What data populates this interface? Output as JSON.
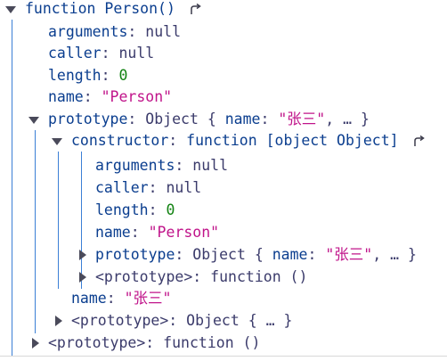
{
  "tree": {
    "root": {
      "kw": "function",
      "name": "Person()",
      "children": {
        "arguments": {
          "key": "arguments",
          "value": "null"
        },
        "caller": {
          "key": "caller",
          "value": "null"
        },
        "length": {
          "key": "length",
          "value": "0"
        },
        "name": {
          "key": "name",
          "value": "\"Person\""
        },
        "prototype": {
          "key": "prototype",
          "summary_type": "Object",
          "summary_open": "{",
          "summary_key": "name",
          "summary_value": "\"张三\"",
          "summary_rest": ", … }",
          "constructor": {
            "key": "constructor",
            "kw": "function",
            "name": {
              "key": "name",
              "value": "\"Person\""
            },
            "arguments": {
              "key": "arguments",
              "value": "null"
            },
            "caller": {
              "key": "caller",
              "value": "null"
            },
            "length": {
              "key": "length",
              "value": "0"
            },
            "prototype": {
              "key": "prototype",
              "summary_type": "Object",
              "summary_open": "{",
              "summary_key": "name",
              "summary_value": "\"张三\"",
              "summary_rest": ", … }"
            },
            "proto": {
              "key": "<prototype>",
              "value": "function ()"
            }
          },
          "name": {
            "key": "name",
            "value": "\"张三\""
          },
          "proto": {
            "key": "<prototype>",
            "summary_type": "Object",
            "summary_rest": "{ … }"
          }
        },
        "proto": {
          "key": "<prototype>",
          "value": "function ()"
        }
      }
    }
  },
  "colors": {
    "key": "#0b3e8f",
    "string": "#c0148a",
    "number": "#128212",
    "guide_line": "#3b7fd6"
  },
  "icons": [
    "chevron-down-icon",
    "chevron-right-icon",
    "jump-to-definition-icon"
  ]
}
